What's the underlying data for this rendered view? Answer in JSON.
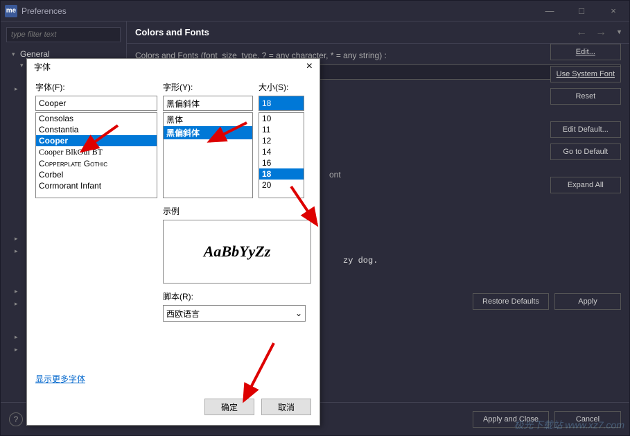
{
  "window": {
    "app_badge": "me",
    "title": "Preferences",
    "minimize": "—",
    "maximize": "□",
    "close": "×"
  },
  "sidebar": {
    "filter_placeholder": "type filter text",
    "items": [
      "General"
    ],
    "chev_down": "▾",
    "chev_right": "▸"
  },
  "content": {
    "heading": "Colors and Fonts",
    "nav_back": "←",
    "nav_fwd": "→",
    "menu_chev": "▾",
    "desc": "Colors and Fonts (font_size_type, ? = any character, * = any string) :",
    "font_label": "ont",
    "buttons": {
      "edit": "Edit...",
      "use_system": "Use System Font",
      "reset": "Reset",
      "edit_default": "Edit Default...",
      "go_default": "Go to Default",
      "expand_all": "Expand All",
      "restore": "Restore Defaults",
      "apply": "Apply"
    },
    "preview_tail": "zy dog."
  },
  "footer": {
    "help": "?",
    "apply_close": "Apply and Close",
    "cancel": "Cancel"
  },
  "dialog": {
    "title": "字体",
    "close": "×",
    "font_label": "字体(F):",
    "style_label": "字形(Y):",
    "size_label": "大小(S):",
    "font_value": "Cooper",
    "style_value": "黑偏斜体",
    "size_value": "18",
    "fonts": [
      "Consolas",
      "Constantia",
      "Cooper",
      "Cooper BlkOul BT",
      "Copperplate Gothic",
      "Corbel",
      "Cormorant Infant"
    ],
    "styles": [
      "黑体",
      "黑偏斜体"
    ],
    "sizes": [
      "10",
      "11",
      "12",
      "14",
      "16",
      "18",
      "20"
    ],
    "sample_label": "示例",
    "sample_text": "AaBbYyZz",
    "script_label": "脚本(R):",
    "script_value": "西欧语言",
    "script_chev": "⌄",
    "more_fonts": "显示更多字体",
    "ok": "确定",
    "cancel": "取消"
  },
  "watermark": "极光下载站 www.xz7.com"
}
